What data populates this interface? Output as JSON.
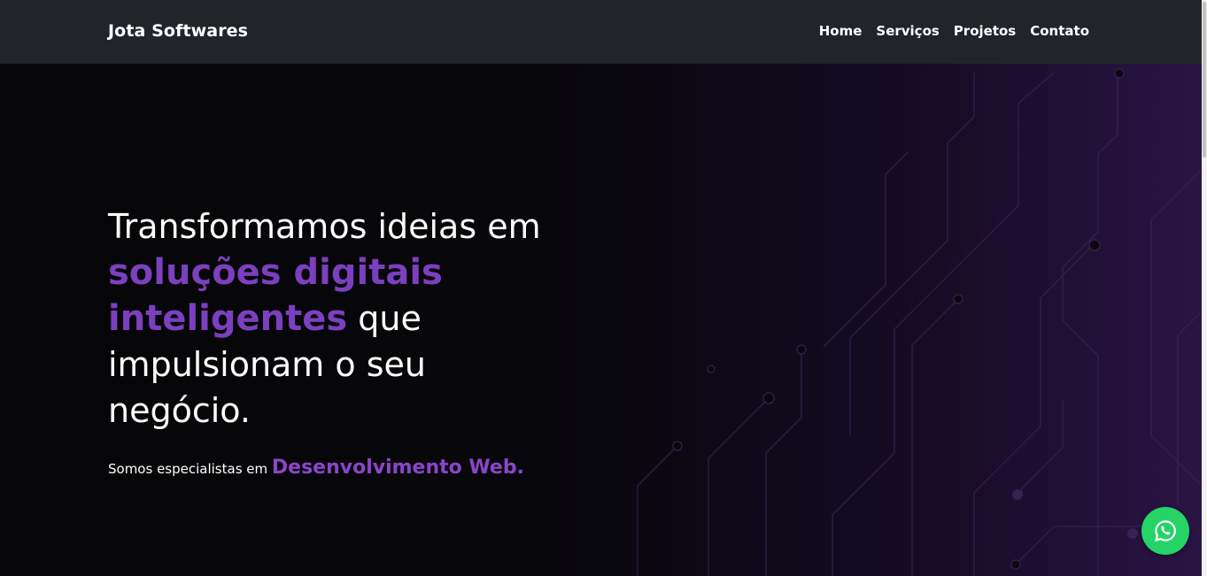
{
  "nav": {
    "brand": "Jota Softwares",
    "links": [
      "Home",
      "Serviços",
      "Projetos",
      "Contato"
    ]
  },
  "hero": {
    "line1": "Transformamos ideias em",
    "line2_accent": "soluções digitais",
    "line3_accent": "inteligentes",
    "line3_rest": " que",
    "line4": "impulsionam o seu",
    "line5": "negócio.",
    "sub_prefix": "Somos especialistas em ",
    "sub_accent": "Desenvolvimento Web."
  },
  "colors": {
    "navbar": "#212529",
    "accent": "#7b3fbf",
    "whatsapp": "#25d366"
  },
  "icons": {
    "floating_button": "whatsapp-icon"
  }
}
